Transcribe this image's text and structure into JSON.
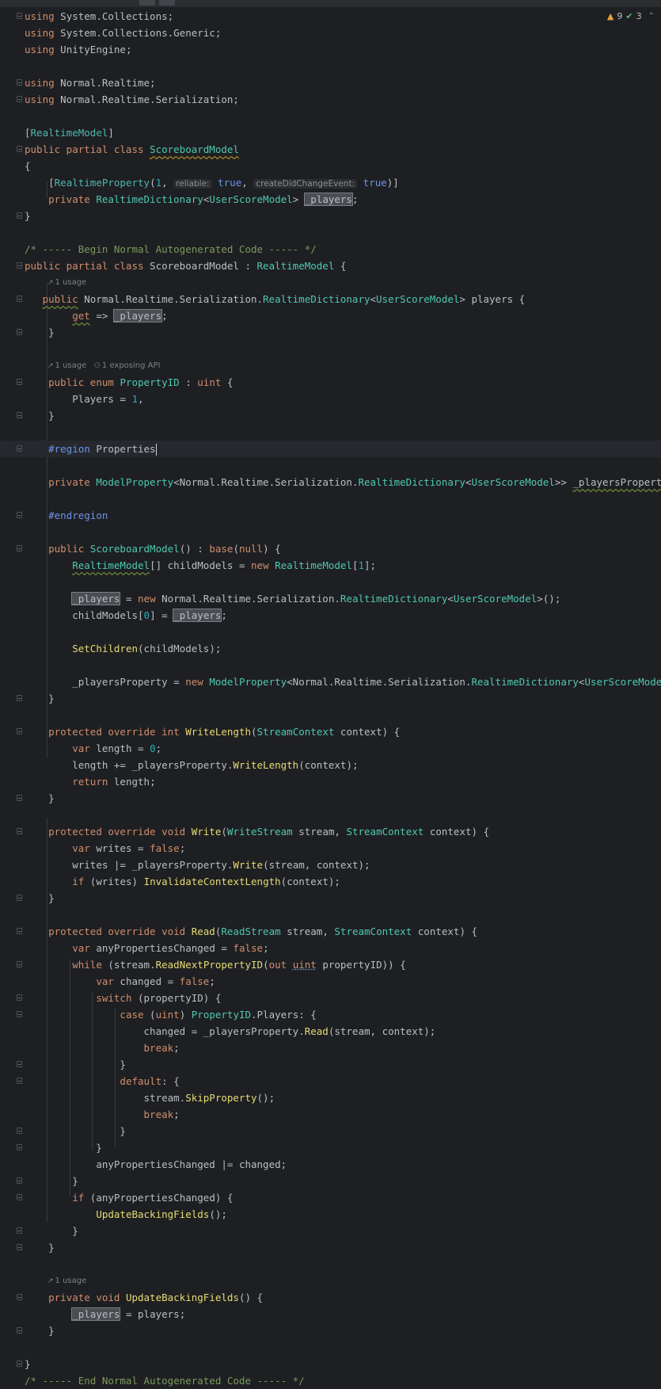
{
  "inspection": {
    "warnings": "9",
    "ok_count": "3",
    "warning_icon": "warning-triangle-icon",
    "ok_icon": "checkmark-icon"
  },
  "code_lens": {
    "usage_1": "1 usage",
    "usage_2": "1 usage",
    "exposing_api": "1 exposing API",
    "usage_3": "1 usage"
  },
  "inlay_hints": {
    "reliable": "reliable:",
    "create_did_change_event": "createDidChangeEvent:"
  },
  "lines": [
    "using System.Collections;",
    "using System.Collections.Generic;",
    "using UnityEngine;",
    "",
    "using Normal.Realtime;",
    "using Normal.Realtime.Serialization;",
    "",
    "[RealtimeModel]",
    "public partial class ScoreboardModel",
    "{",
    "    [RealtimeProperty(1, reliable: true, createDidChangeEvent: true)]",
    "    private RealtimeDictionary<UserScoreModel> _players;",
    "}",
    "",
    "/* ----- Begin Normal Autogenerated Code ----- */",
    "public partial class ScoreboardModel : RealtimeModel {"
  ],
  "colors": {
    "background": "#1e1f22",
    "keyword": "#cf8e6d",
    "type": "#4ec9b0",
    "number": "#2aacb8",
    "comment": "#7a9a5c",
    "method": "#e6db74"
  }
}
